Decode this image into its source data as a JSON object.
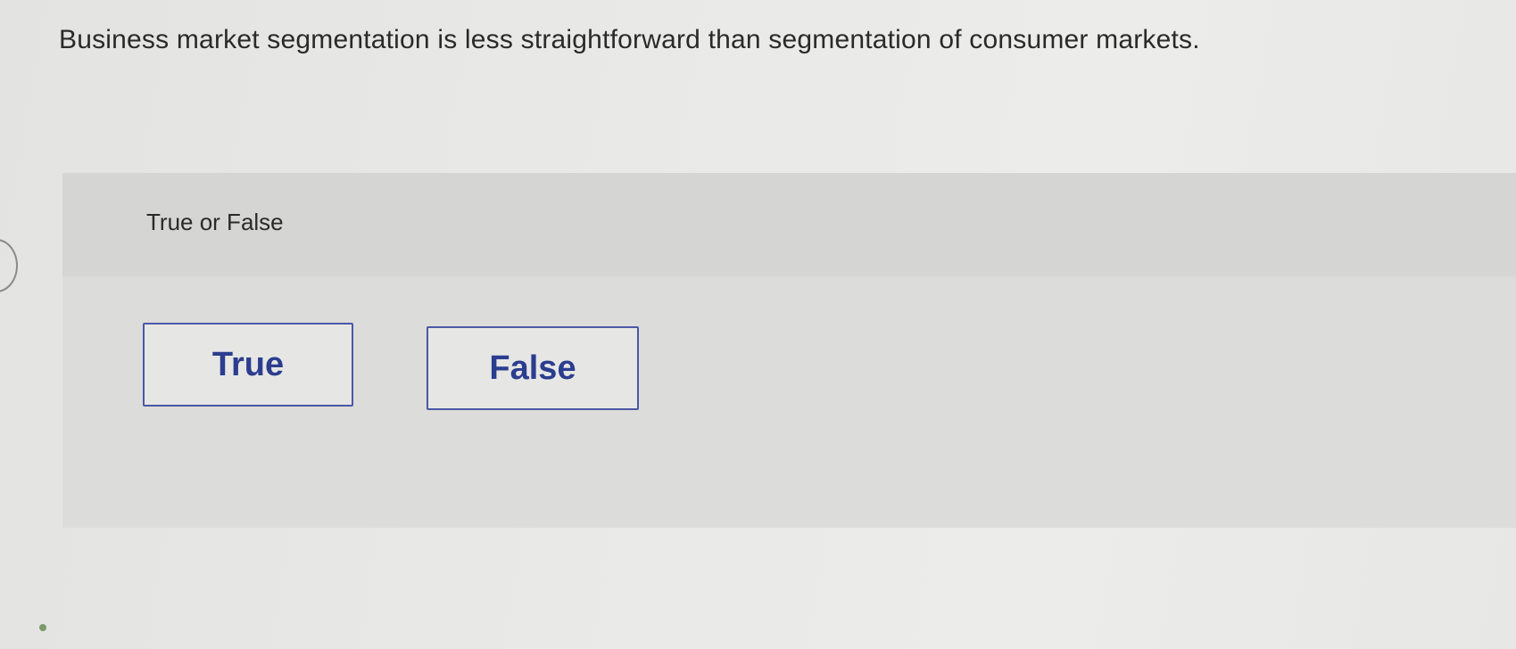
{
  "question": {
    "text": "Business market segmentation is less straightforward than segmentation of consumer markets."
  },
  "prompt": {
    "label": "True or False"
  },
  "choices": [
    {
      "label": "True"
    },
    {
      "label": "False"
    }
  ],
  "colors": {
    "button_border": "#4a58a6",
    "button_text": "#2b3d8f",
    "panel_background": "#dcdcda",
    "prompt_band": "#d5d5d3"
  }
}
